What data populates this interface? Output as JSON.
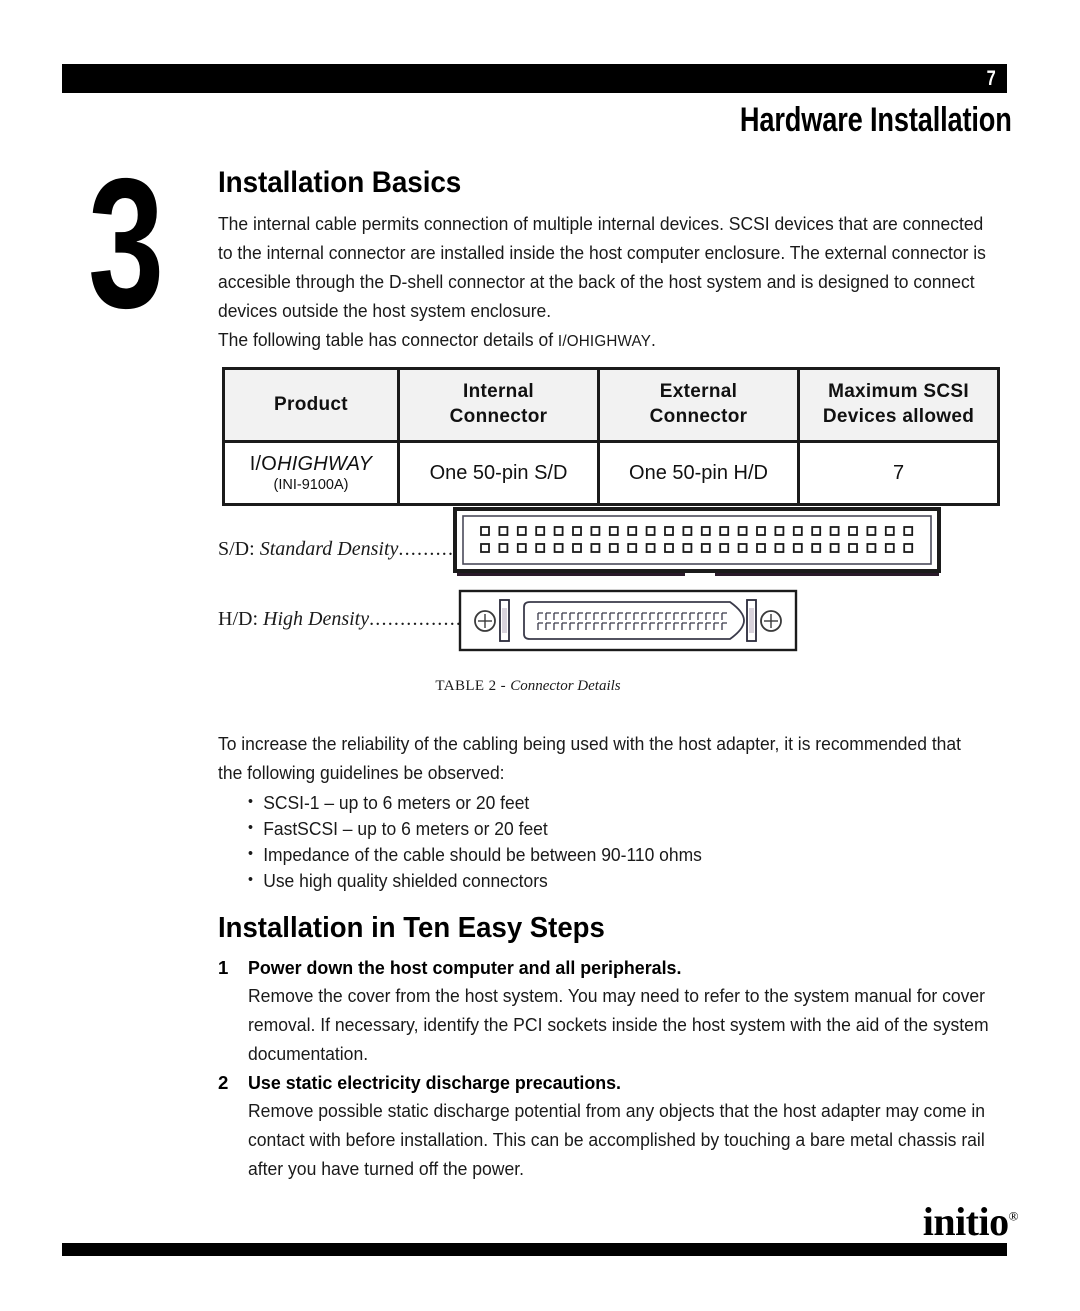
{
  "header": {
    "page_number": "7",
    "chapter_title": "Hardware Installation"
  },
  "chapter": {
    "number": "3",
    "section_title": "Installation Basics",
    "intro_paragraph": "The internal cable permits connection of multiple internal devices. SCSI devices that are connected to the internal connector are installed inside the host computer enclosure. The external connector is accesible through the D-shell connector at the back of the host system and is designed to connect devices outside the host system enclosure.",
    "table_lead_prefix": "The following table has connector details of ",
    "table_lead_product": "I/OHIGHWAY",
    "table_lead_suffix": "."
  },
  "table": {
    "headers": [
      "Product",
      "Internal Connector",
      "External Connector",
      "Maximum SCSI Devices allowed"
    ],
    "headers_split": [
      [
        "Product",
        ""
      ],
      [
        "Internal",
        "Connector"
      ],
      [
        "External",
        "Connector"
      ],
      [
        "Maximum SCSI",
        "Devices allowed"
      ]
    ],
    "rows": [
      {
        "product_io": "I/O",
        "product_highway": "HIGHWAY",
        "product_code": "(INI-9100A)",
        "internal_connector": "One 50-pin S/D",
        "external_connector": "One 50-pin H/D",
        "max_devices": "7"
      }
    ],
    "caption_lead": "TABLE 2 - ",
    "caption_title": "Connector Details"
  },
  "legend": {
    "sd_abbr": "S/D:",
    "sd_term": " Standard Density",
    "sd_dots": "...........",
    "hd_abbr": "H/D:",
    "hd_term": " High Density",
    "hd_dots": "................."
  },
  "guidelines": {
    "lead": "To increase the reliability of the cabling being used with the host adapter, it is recommended that the following guidelines be observed:",
    "items": [
      "SCSI-1 – up to 6 meters or 20 feet",
      "FastSCSI – up to 6 meters or 20 feet",
      "Impedance of the cable should be between 90-110 ohms",
      "Use high quality shielded connectors"
    ]
  },
  "steps_section": {
    "title": "Installation in Ten Easy Steps",
    "steps": [
      {
        "number": "1",
        "title": "Power down the host computer and all peripherals.",
        "body": "Remove the cover from the host system. You may need to refer to the system manual for cover removal. If necessary, identify the PCI sockets inside the host system with the aid of the system documentation."
      },
      {
        "number": "2",
        "title": "Use static electricity discharge precautions.",
        "body": "Remove possible static discharge potential from any objects that the host adapter may come in contact with before installation. This can be accomplished by touching a bare metal chassis rail after you have turned off the power."
      }
    ]
  },
  "footer": {
    "logo_text": "initio",
    "logo_mark": "®"
  },
  "colors": {
    "bar": "#000000",
    "text": "#1a1a1a",
    "table_header_bg": "#f2f2f2",
    "table_border": "#1b1b1b",
    "page_bg": "#ffffff"
  }
}
